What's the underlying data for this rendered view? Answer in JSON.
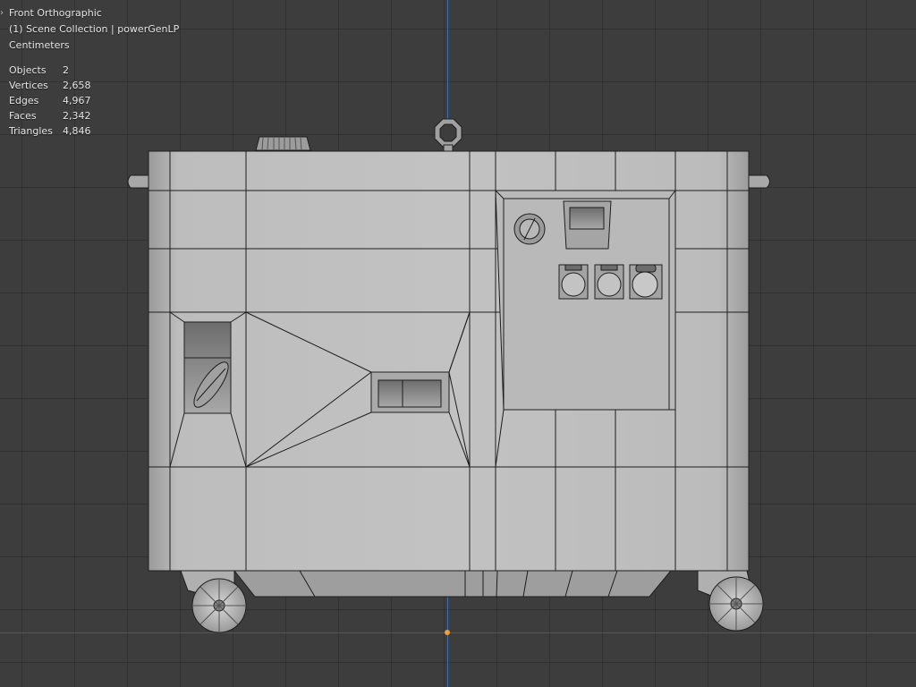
{
  "viewport": {
    "view_name": "Front Orthographic",
    "collection": "(1) Scene Collection | powerGenLP",
    "units": "Centimeters"
  },
  "stats": [
    {
      "label": "Objects",
      "value": "2"
    },
    {
      "label": "Vertices",
      "value": "2,658"
    },
    {
      "label": "Edges",
      "value": "4,967"
    },
    {
      "label": "Faces",
      "value": "2,342"
    },
    {
      "label": "Triangles",
      "value": "4,846"
    }
  ],
  "colors": {
    "background": "#3d3d3d",
    "grid_line": "#333333",
    "axis_z": "#3f6fb0",
    "axis_x": "#9a3a3a",
    "origin": "#f0a030",
    "mesh_fill": "#b4b4b4",
    "mesh_edge": "#1e1e1e"
  },
  "icons": {
    "overlay_toggle": "chevron-right-icon"
  }
}
